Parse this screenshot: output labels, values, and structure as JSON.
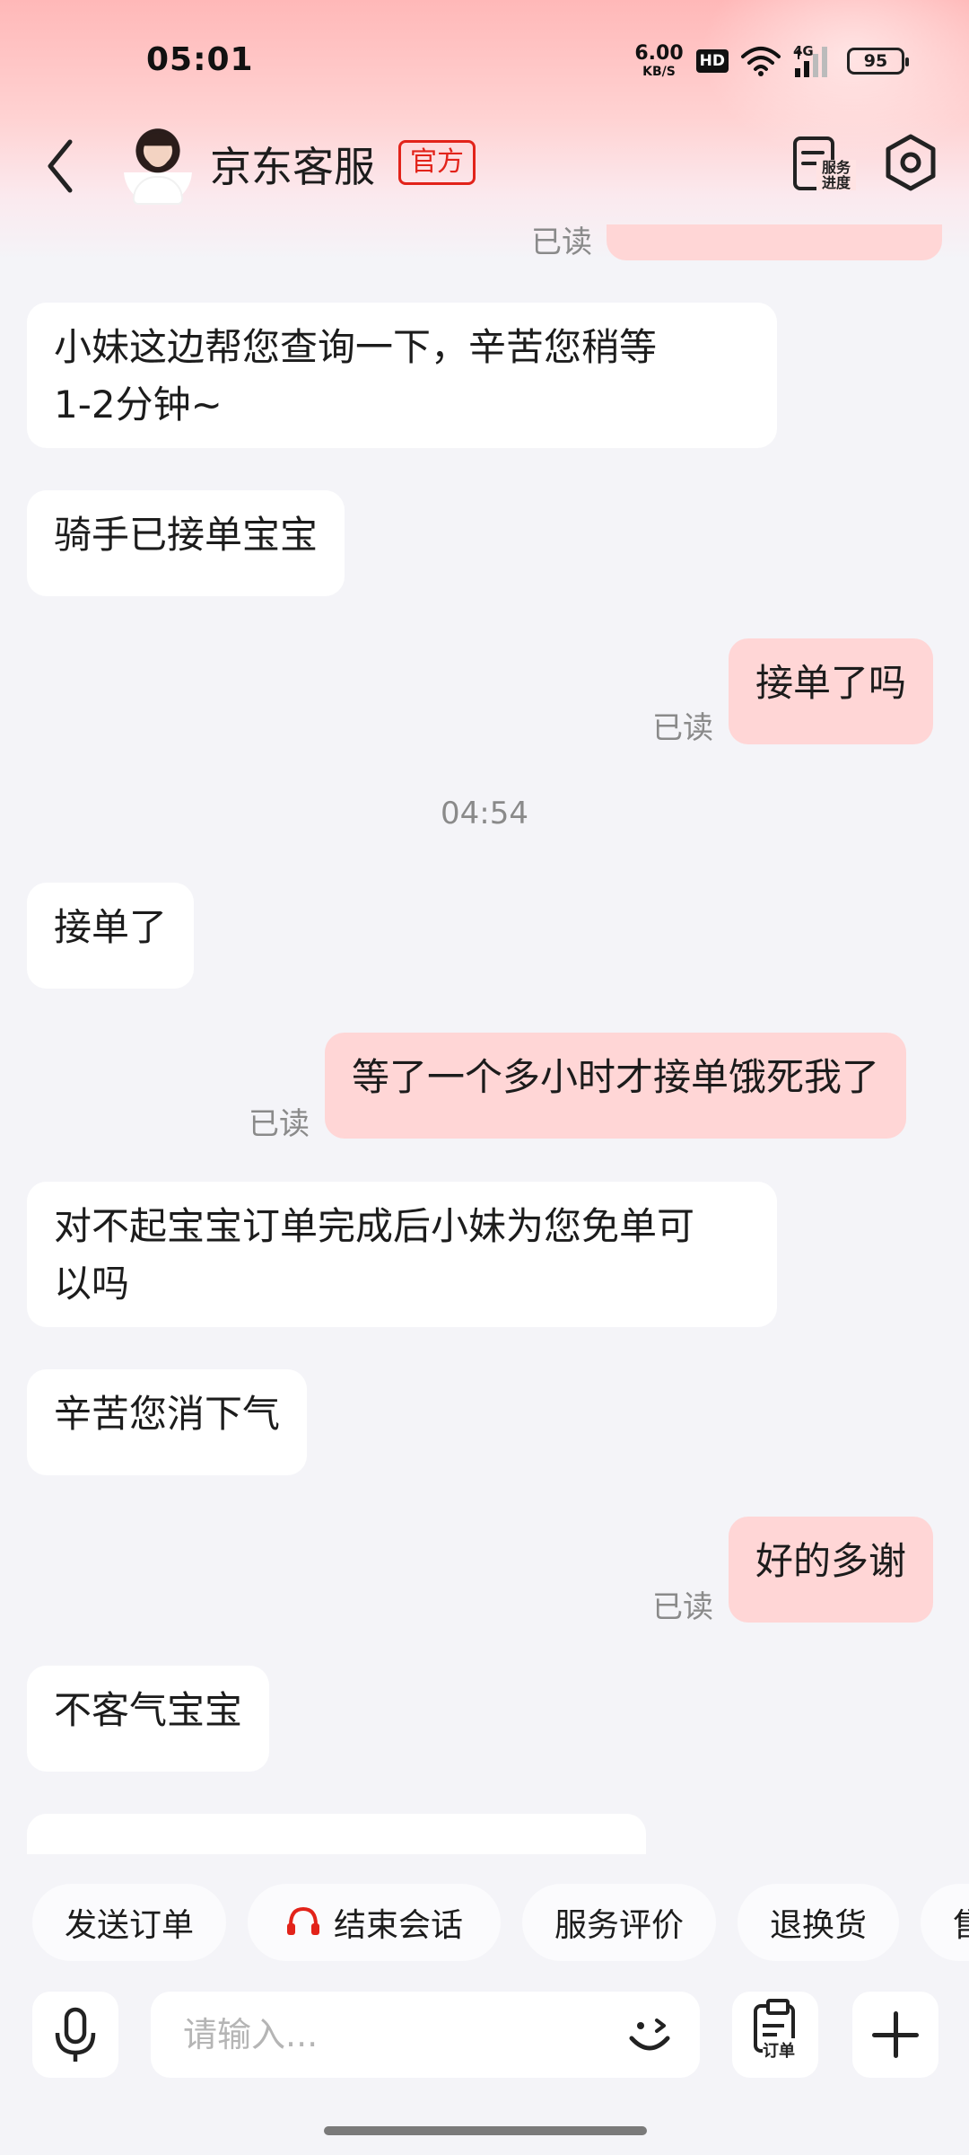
{
  "status_bar": {
    "time": "05:01",
    "net_speed_value": "6.00",
    "net_speed_unit": "KB/S",
    "hd_label": "HD",
    "network_type": "4G",
    "battery": "95"
  },
  "header": {
    "title": "京东客服",
    "official_tag": "官方",
    "service_progress_label": "服务进度"
  },
  "chat": {
    "read_label": "已读",
    "timestamp": "04:54",
    "messages": [
      {
        "side": "in",
        "text": "小妹这边帮您查询一下，辛苦您稍等\n1-2分钟~"
      },
      {
        "side": "in",
        "text": "骑手已接单宝宝"
      },
      {
        "side": "out",
        "text": "接单了吗"
      },
      {
        "side": "in",
        "text": "接单了"
      },
      {
        "side": "out",
        "text": "等了一个多小时才接单饿死我了"
      },
      {
        "side": "in",
        "text": "对不起宝宝订单完成后小妹为您免单可\n以吗"
      },
      {
        "side": "in",
        "text": "辛苦您消下气"
      },
      {
        "side": "out",
        "text": "好的多谢"
      },
      {
        "side": "in",
        "text": "不客气宝宝"
      }
    ]
  },
  "quick_actions": [
    {
      "label": "发送订单",
      "icon": ""
    },
    {
      "label": "结束会话",
      "icon": "headset-icon"
    },
    {
      "label": "服务评价",
      "icon": ""
    },
    {
      "label": "退换货",
      "icon": ""
    },
    {
      "label": "售",
      "icon": ""
    }
  ],
  "input": {
    "placeholder": "请输入...",
    "order_label": "订单"
  },
  "colors": {
    "brand_red": "#e2231a",
    "outgoing_bubble": "#ffd6d6",
    "incoming_bubble": "#ffffff",
    "background": "#f4f4f8"
  }
}
